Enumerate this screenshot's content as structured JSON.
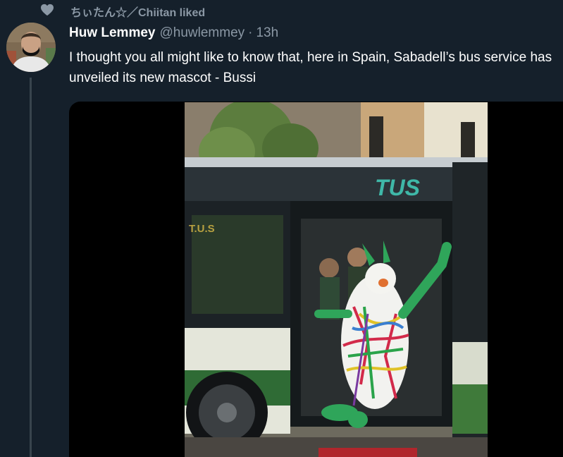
{
  "social_context": {
    "icon": "heart-icon",
    "text": "ちぃたん☆／Chiitan liked"
  },
  "author": {
    "name": "Huw Lemmey",
    "handle": "@huwlemmey",
    "separator": "·",
    "time": "13h",
    "avatar": "avatar"
  },
  "tweet": {
    "text": "I thought you all might like to know that, here in Spain, Sabadell’s bus service has unveiled its new mascot - Bussi"
  },
  "media": {
    "type": "video",
    "bus_logo": "TUS",
    "side_text": "T.U.S"
  },
  "colors": {
    "background": "#15202b",
    "secondary_text": "#8b98a5",
    "thread_line": "#38444d"
  }
}
